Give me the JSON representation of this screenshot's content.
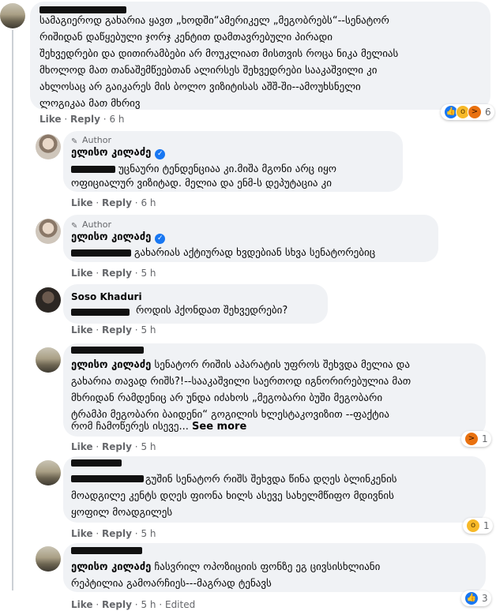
{
  "comments": [
    {
      "id": "c1",
      "lines": [
        "სამაგიეროდ გახარია ყავთ „ხოდში“ამერიკელ „მეგობრებს“--სენატორ",
        "რიშიდან დაწყებული ჯორჯ კენტით დამთავრებული პირადი",
        "შეხვედრები და დითირამბები არ მოუკლიათ მისთვის როცა ნიკა მელიას",
        "მხოლოდ მათ თანაშემწეებთან ალირსეს შეხვედრები სააკაშვილი კი",
        "ახლოსაც არ გაიკარეს მის ბოლო ვიზიტისას აშშ-ში--ამოუხსნელი",
        "ლოგიკაა მათ მხრივ"
      ],
      "like": "Like",
      "reply": "Reply",
      "time": "6 h",
      "reaction_count": "6"
    },
    {
      "id": "c2",
      "author_tag": "Author",
      "name": "ელისო კილაძე",
      "lines": [
        "უცნაური ტენდენციაა კი.მიშა მგონი არც იყო",
        "ოფიციალურ ვიზიტად. მელია და ენმ-ს დეპუტაცია კი"
      ],
      "like": "Like",
      "reply": "Reply",
      "time": "6 h"
    },
    {
      "id": "c3",
      "author_tag": "Author",
      "name": "ელისო კილაძე",
      "lines": [
        "გახარიას აქტიურად ხვდებიან სხვა სენატორებიც"
      ],
      "like": "Like",
      "reply": "Reply",
      "time": "5 h"
    },
    {
      "id": "c4",
      "name": "Soso Khaduri",
      "lines": [
        "როდის ჰქონდათ შეხვედრები?"
      ],
      "like": "Like",
      "reply": "Reply",
      "time": "5 h"
    },
    {
      "id": "c5",
      "tagged": "ელისო კილაძე",
      "lines": [
        "სენატორ რიშის აპარატის უფროს შეხვდა მელია და",
        "გახარია თავად რიშს?!--სააკაშვილი საერთოდ იგნორირებულია მათ",
        "მხრიდან რამდენიც არ უნდა იძახოს „მეგობარი ბუში მეგობარი",
        "ტრამპი მეგობარი ბაიდენი“ გოგილის ხლესტაკოვიზით --ფაქტია",
        "რომ ჩამოწერეს ისევე..."
      ],
      "see_more": "See more",
      "like": "Like",
      "reply": "Reply",
      "time": "5 h",
      "reaction_count": "1"
    },
    {
      "id": "c6",
      "lines": [
        "გუშინ სენატორ რიშს შეხვდა წინა დღეს ბლინკენის",
        "მოადგილე კენტს დღეს ფიონა ხილს ასევე სახელმწიფო მდივნის",
        "ყოფილ მოადგილეს"
      ],
      "like": "Like",
      "reply": "Reply",
      "time": "5 h",
      "reaction_count": "1"
    },
    {
      "id": "c7",
      "tagged": "ელისო კილაძე",
      "lines": [
        "ჩასვრილ ოპოზიციის ფონზე ეგ ცივსისხლიანი",
        "რეპტილია გამოარჩიეს---მაგრად ტენავს"
      ],
      "like": "Like",
      "reply": "Reply",
      "time": "5 h",
      "edited": "Edited",
      "reaction_count": "3"
    }
  ],
  "ui": {
    "dot": "·"
  },
  "icons": {
    "like": "like-reaction-icon",
    "wow": "wow-reaction-icon",
    "angry": "angry-reaction-icon",
    "pen": "pencil-icon",
    "verified": "verified-badge-icon"
  },
  "colors": {
    "bubble": "#f0f2f5",
    "meta": "#65676b",
    "like_blue": "#1877f2"
  }
}
